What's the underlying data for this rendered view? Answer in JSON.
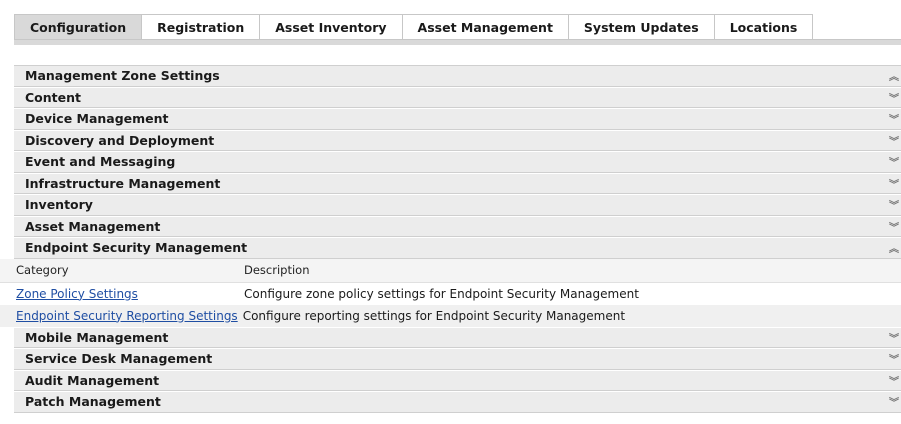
{
  "tabs": [
    {
      "label": "Configuration",
      "active": true
    },
    {
      "label": "Registration",
      "active": false
    },
    {
      "label": "Asset Inventory",
      "active": false
    },
    {
      "label": "Asset Management",
      "active": false
    },
    {
      "label": "System Updates",
      "active": false
    },
    {
      "label": "Locations",
      "active": false
    }
  ],
  "sections": {
    "header": {
      "label": "Management Zone Settings",
      "icon": "collapse-icon"
    },
    "items_before": [
      {
        "label": "Content",
        "icon": "expand-icon"
      },
      {
        "label": "Device Management",
        "icon": "expand-icon"
      },
      {
        "label": "Discovery and Deployment",
        "icon": "expand-icon"
      },
      {
        "label": "Event and Messaging",
        "icon": "expand-icon"
      },
      {
        "label": "Infrastructure Management",
        "icon": "expand-icon"
      },
      {
        "label": "Inventory",
        "icon": "expand-icon"
      },
      {
        "label": "Asset Management",
        "icon": "expand-icon"
      }
    ],
    "expanded": {
      "label": "Endpoint Security Management",
      "icon": "collapse-icon",
      "columns": {
        "category": "Category",
        "description": "Description"
      },
      "rows": [
        {
          "category": "Zone Policy Settings",
          "description": "Configure zone policy settings for Endpoint Security Management"
        },
        {
          "category": "Endpoint Security Reporting Settings",
          "description": "Configure reporting settings for Endpoint Security Management"
        }
      ]
    },
    "items_after": [
      {
        "label": "Mobile Management",
        "icon": "expand-icon"
      },
      {
        "label": "Service Desk Management",
        "icon": "expand-icon"
      },
      {
        "label": "Audit Management",
        "icon": "expand-icon"
      },
      {
        "label": "Patch Management",
        "icon": "expand-icon"
      }
    ]
  },
  "glyphs": {
    "collapse": "︽",
    "expand": "︾"
  }
}
